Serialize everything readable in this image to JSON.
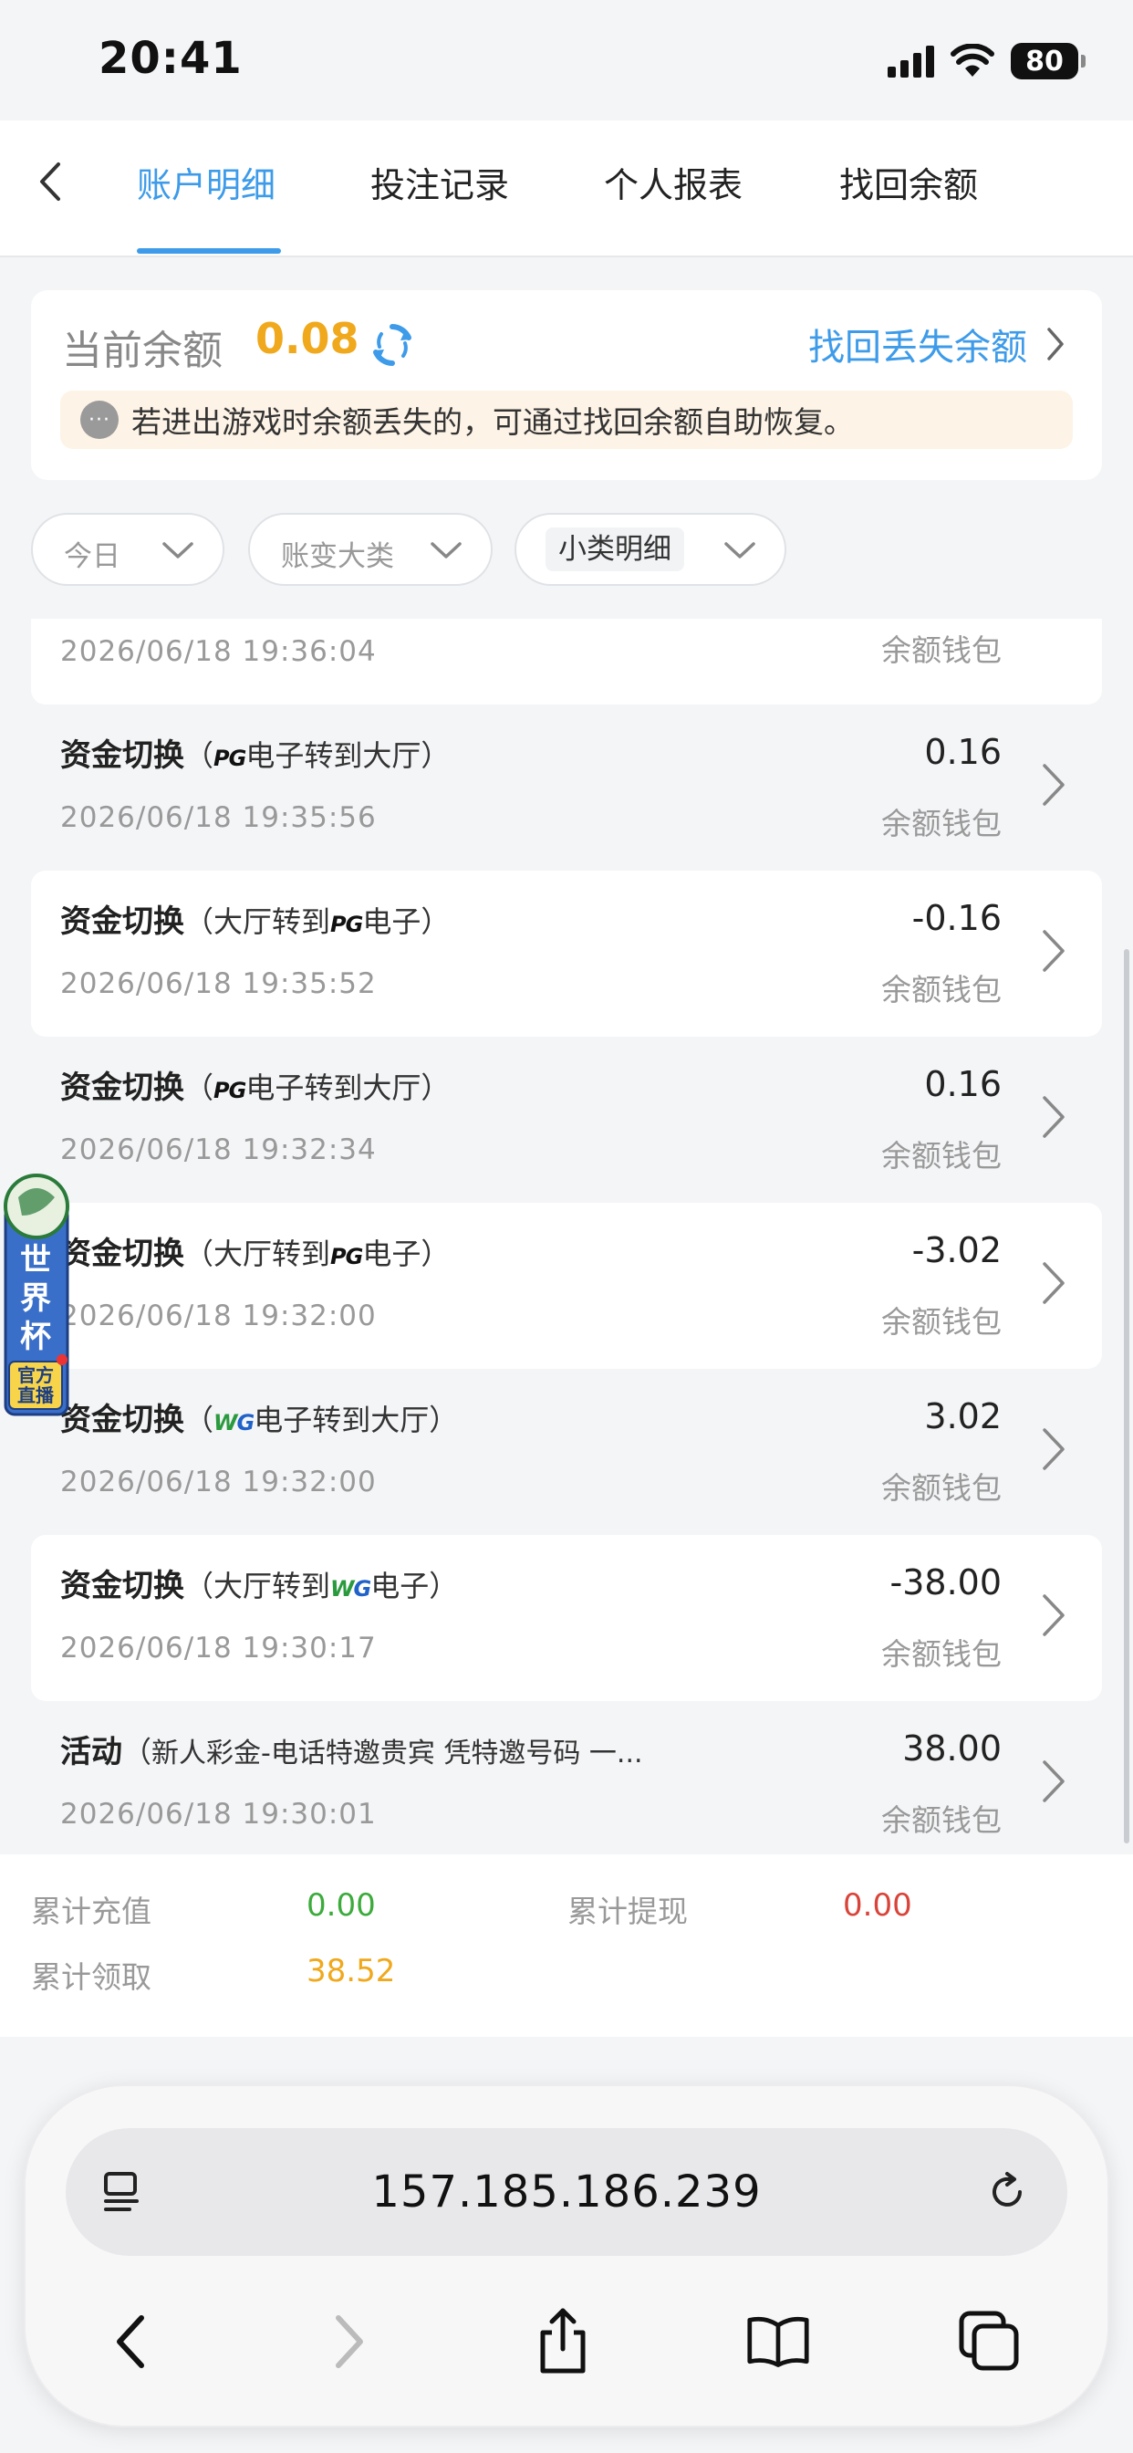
{
  "status": {
    "time": "20:41",
    "battery": "80"
  },
  "nav": {
    "tabs": [
      {
        "label": "账户明细",
        "active": true
      },
      {
        "label": "投注记录",
        "active": false
      },
      {
        "label": "个人报表",
        "active": false
      },
      {
        "label": "找回余额",
        "active": false
      }
    ]
  },
  "balance": {
    "label": "当前余额",
    "amount": "0.08",
    "recover_link": "找回丢失余额",
    "notice": "若进出游戏时余额丢失的，可通过找回余额自助恢复。",
    "notice_bubble": "···"
  },
  "filters": [
    {
      "label": "今日"
    },
    {
      "label": "账变大类"
    },
    {
      "label": "小类明细"
    }
  ],
  "records": {
    "partial_top": {
      "date": "2026/06/18 19:36:04",
      "wallet": "余额钱包"
    },
    "items": [
      {
        "category": "资金切换",
        "open": "（",
        "before": "",
        "logo": "PG",
        "after": "电子转到大厅",
        "close": "）",
        "date": "2026/06/18 19:35:56",
        "amount": "0.16",
        "wallet": "余额钱包"
      },
      {
        "category": "资金切换",
        "open": "（",
        "before": "大厅转到",
        "logo": "PG",
        "after": "电子",
        "close": "）",
        "date": "2026/06/18 19:35:52",
        "amount": "-0.16",
        "wallet": "余额钱包"
      },
      {
        "category": "资金切换",
        "open": "（",
        "before": "",
        "logo": "PG",
        "after": "电子转到大厅",
        "close": "）",
        "date": "2026/06/18 19:32:34",
        "amount": "0.16",
        "wallet": "余额钱包"
      },
      {
        "category": "资金切换",
        "open": "（",
        "before": "大厅转到",
        "logo": "PG",
        "after": "电子",
        "close": "）",
        "date": "2026/06/18 19:32:00",
        "amount": "-3.02",
        "wallet": "余额钱包"
      },
      {
        "category": "资金切换",
        "open": "（",
        "before": "",
        "logo": "WG",
        "after": "电子转到大厅",
        "close": "）",
        "date": "2026/06/18 19:32:00",
        "amount": "3.02",
        "wallet": "余额钱包"
      },
      {
        "category": "资金切换",
        "open": "（",
        "before": "大厅转到",
        "logo": "WG",
        "after": "电子",
        "close": "）",
        "date": "2026/06/18 19:30:17",
        "amount": "-38.00",
        "wallet": "余额钱包"
      },
      {
        "category": "活动",
        "open": "（",
        "before": "新人彩金-电话特邀贵宾 凭特邀号码 一...",
        "logo": "",
        "after": "",
        "close": "",
        "date": "2026/06/18 19:30:01",
        "amount": "38.00",
        "wallet": "余额钱包"
      }
    ]
  },
  "promo": {
    "badge": "世界杯",
    "sub": "官方直播"
  },
  "summary": {
    "recharge_label": "累计充值",
    "recharge_value": "0.00",
    "withdraw_label": "累计提现",
    "withdraw_value": "0.00",
    "claim_label": "累计领取",
    "claim_value": "38.52"
  },
  "browser": {
    "url": "157.185.186.239"
  },
  "colors": {
    "accent": "#3d9be9",
    "gold": "#f0a81c",
    "green": "#3cab3c",
    "red": "#d9443a"
  }
}
